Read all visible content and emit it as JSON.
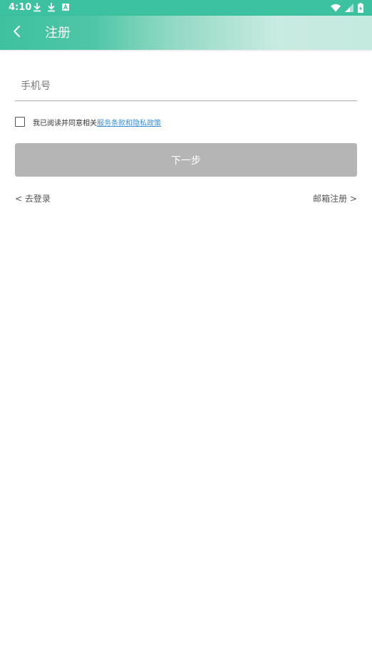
{
  "status_bar": {
    "time": "4:10",
    "icons": [
      "download-icon",
      "download-icon",
      "text-a-icon",
      "wifi-icon",
      "signal-icon",
      "battery-icon"
    ]
  },
  "app_bar": {
    "title": "注册",
    "back_icon": "chevron-left-icon"
  },
  "form": {
    "phone_placeholder": "手机号",
    "phone_value": "",
    "agree_prefix": "我已阅读并同意相关",
    "agree_link": "服务条款和隐私政策",
    "agree_checked": false,
    "next_label": "下一步"
  },
  "links": {
    "login": "< 去登录",
    "email_register": "邮箱注册 >"
  },
  "colors": {
    "status_bar": "#3cc2a0",
    "app_bar_start": "#3ec19f",
    "app_bar_end": "#c4e9de",
    "button_disabled": "#b5b5b5",
    "link": "#3a8fd9"
  }
}
